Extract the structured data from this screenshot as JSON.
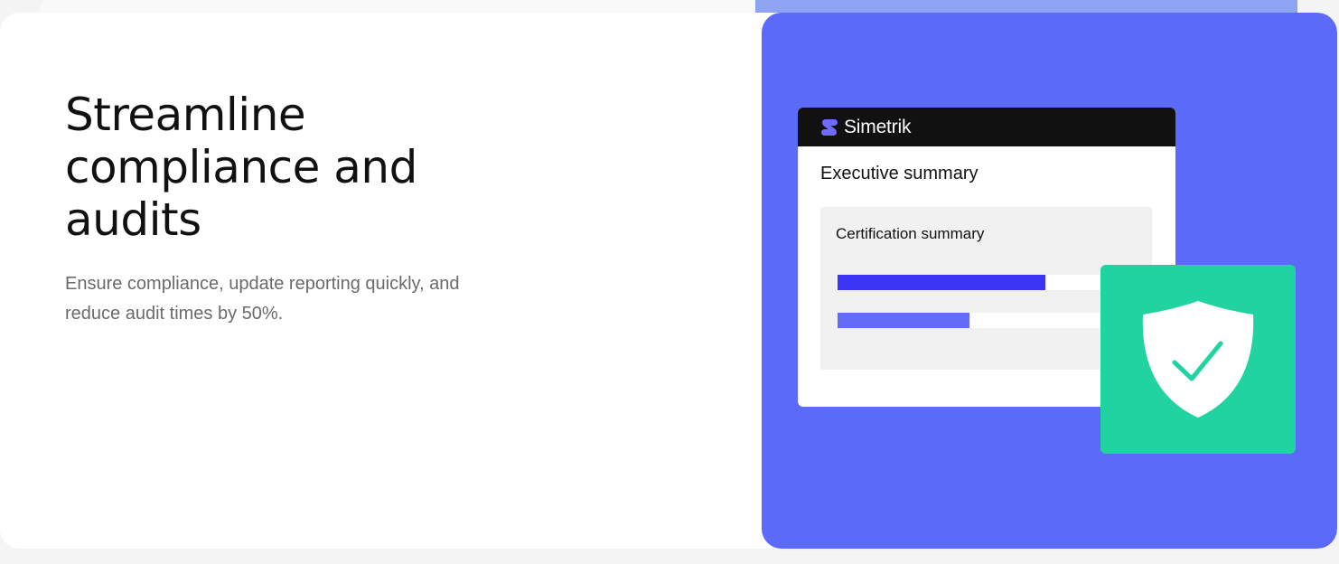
{
  "hero": {
    "title": "Streamline compliance and audits",
    "description": "Ensure compliance, update reporting quickly, and reduce audit times by 50%."
  },
  "illustration": {
    "brand": "Simetrik",
    "window_title": "Executive summary",
    "panel_title": "Certification summary",
    "progress_bars": [
      {
        "value": 0.66,
        "color": "#3c35f5"
      },
      {
        "value": 0.42,
        "color": "#646cf6"
      }
    ],
    "badge_icon": "shield-check-icon"
  },
  "colors": {
    "accent": "#5b6af8",
    "badge": "#22d3a2",
    "window_bar": "#111111"
  }
}
